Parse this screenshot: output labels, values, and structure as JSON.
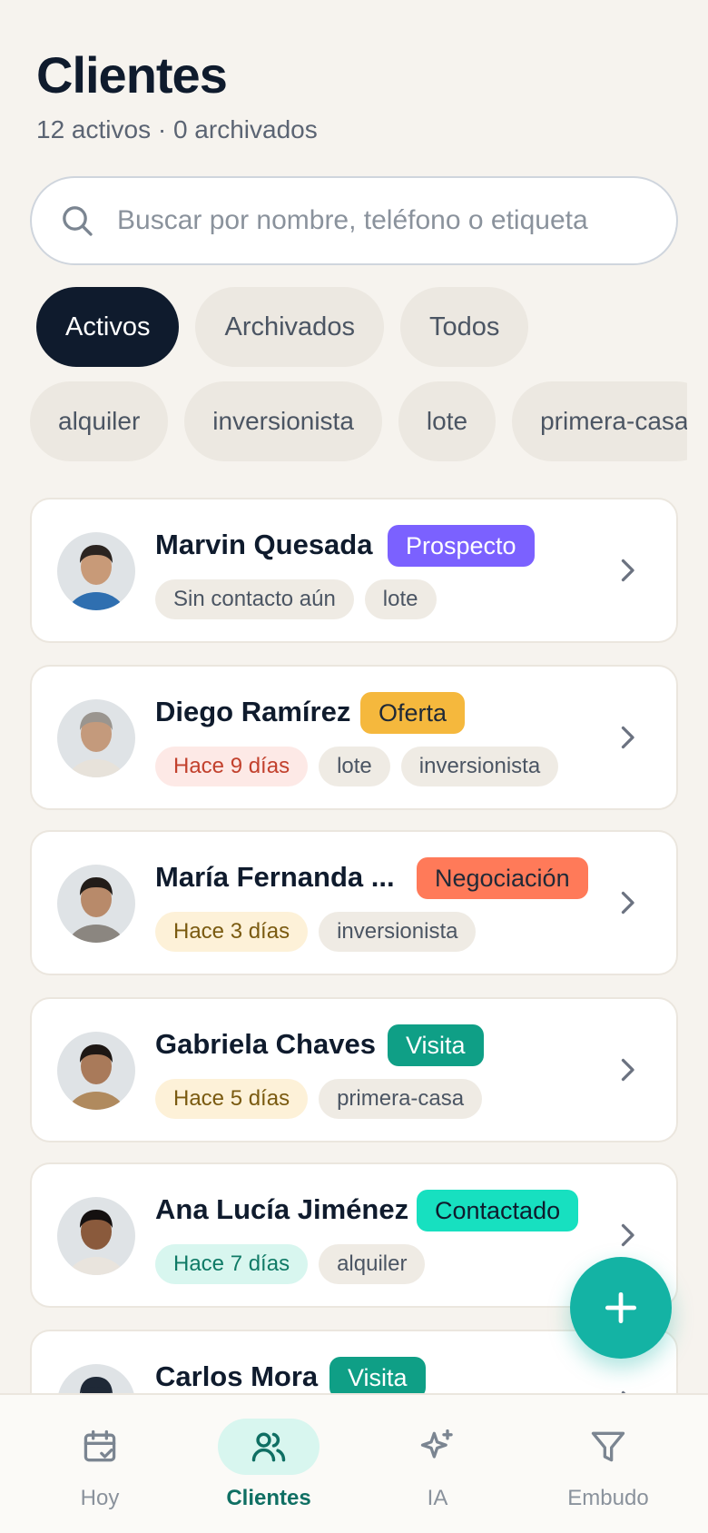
{
  "header": {
    "title": "Clientes",
    "subtitle": "12 activos · 0 archivados"
  },
  "search": {
    "placeholder": "Buscar por nombre, teléfono o etiqueta",
    "value": ""
  },
  "filters": [
    "Activos",
    "Archivados",
    "Todos"
  ],
  "active_filter": "Activos",
  "tag_filters": [
    "alquiler",
    "inversionista",
    "lote",
    "primera-casa"
  ],
  "clients": [
    {
      "name": "Marvin Quesada",
      "stage": "Prospecto",
      "stage_color": "#7b61ff",
      "stage_text_color": "#ffffff",
      "last_contact": "Sin contacto aún",
      "last_contact_tone": "neutral",
      "tags": [
        "lote"
      ]
    },
    {
      "name": "Diego Ramírez",
      "stage": "Oferta",
      "stage_color": "#f5b83d",
      "stage_text_color": "#1f2937",
      "last_contact": "Hace 9 días",
      "last_contact_tone": "red",
      "tags": [
        "lote",
        "inversionista"
      ]
    },
    {
      "name": "María Fernanda ...",
      "stage": "Negociación",
      "stage_color": "#ff7a59",
      "stage_text_color": "#1f2937",
      "last_contact": "Hace 3 días",
      "last_contact_tone": "amber",
      "tags": [
        "inversionista"
      ]
    },
    {
      "name": "Gabriela Chaves",
      "stage": "Visita",
      "stage_color": "#0f9f86",
      "stage_text_color": "#ffffff",
      "last_contact": "Hace 5 días",
      "last_contact_tone": "amber",
      "tags": [
        "primera-casa"
      ]
    },
    {
      "name": "Ana Lucía Jiménez",
      "stage": "Contactado",
      "stage_color": "#17e0c0",
      "stage_text_color": "#0f1b2d",
      "last_contact": "Hace 7 días",
      "last_contact_tone": "teal",
      "tags": [
        "alquiler"
      ]
    },
    {
      "name": "Carlos Mora",
      "stage": "Visita",
      "stage_color": "#0f9f86",
      "stage_text_color": "#ffffff",
      "last_contact": "",
      "last_contact_tone": "neutral",
      "tags": []
    }
  ],
  "nav": [
    {
      "label": "Hoy",
      "icon": "calendar-icon",
      "active": false
    },
    {
      "label": "Clientes",
      "icon": "users-icon",
      "active": true
    },
    {
      "label": "IA",
      "icon": "sparkles-icon",
      "active": false
    },
    {
      "label": "Embudo",
      "icon": "funnel-icon",
      "active": false
    }
  ],
  "colors": {
    "background": "#f6f3ee",
    "accent": "#14b3a4",
    "dark": "#0f1b2d"
  }
}
